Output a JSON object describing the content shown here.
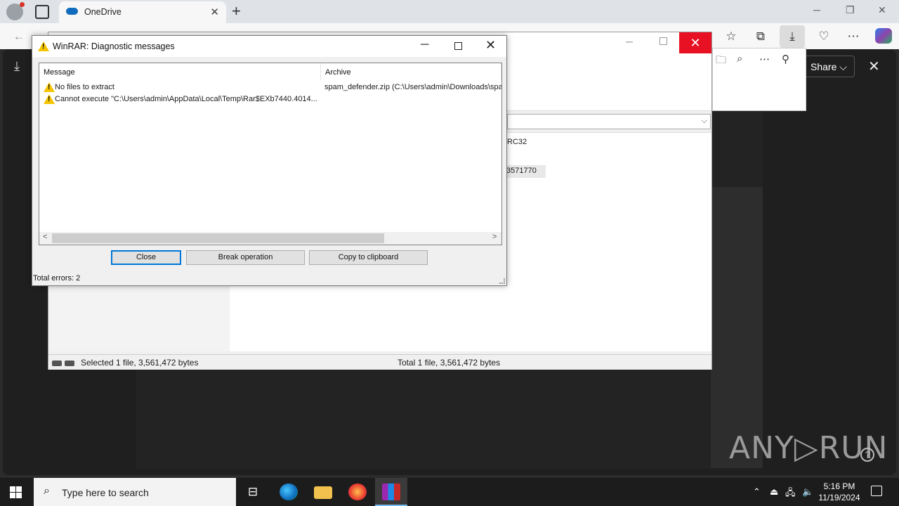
{
  "browser": {
    "tab_title": "OneDrive",
    "tab_close": "✕",
    "new_tab": "+",
    "minimize": "─",
    "restore": "❐",
    "close": "✕",
    "share_label": "Share",
    "share_chevron": "⌵",
    "viewer_close": "✕"
  },
  "winrar_main": {
    "crc_header": "RC32",
    "crc_value": "3571770",
    "status_left": "Selected 1 file, 3,561,472 bytes",
    "status_right": "Total 1 file, 3,561,472 bytes"
  },
  "dialog": {
    "title": "WinRAR: Diagnostic messages",
    "columns": [
      "Message",
      "Archive"
    ],
    "rows": [
      {
        "message": "No files to extract",
        "archive": "spam_defender.zip (C:\\Users\\admin\\Downloads\\spa"
      },
      {
        "message": "Cannot execute \"C:\\Users\\admin\\AppData\\Local\\Temp\\Rar$EXb7440.4014...",
        "archive": ""
      }
    ],
    "buttons": {
      "close": "Close",
      "break": "Break operation",
      "copy": "Copy to clipboard"
    },
    "status": "Total errors: 2"
  },
  "watermark": {
    "text": "ANY▷RUN",
    "help": "?"
  },
  "taskbar": {
    "search_placeholder": "Type here to search",
    "time": "5:16 PM",
    "date": "11/19/2024"
  },
  "icons": [
    "profile-icon",
    "tab-actions-icon",
    "onedrive-icon",
    "download-icon",
    "search-icon",
    "folder-icon",
    "pin-icon",
    "more-icon",
    "warning-icon",
    "windows-start-icon",
    "task-view-icon",
    "edge-icon",
    "file-explorer-icon",
    "firefox-icon",
    "winrar-icon",
    "chevron-up-icon",
    "network-icon",
    "volume-icon",
    "notification-icon"
  ]
}
